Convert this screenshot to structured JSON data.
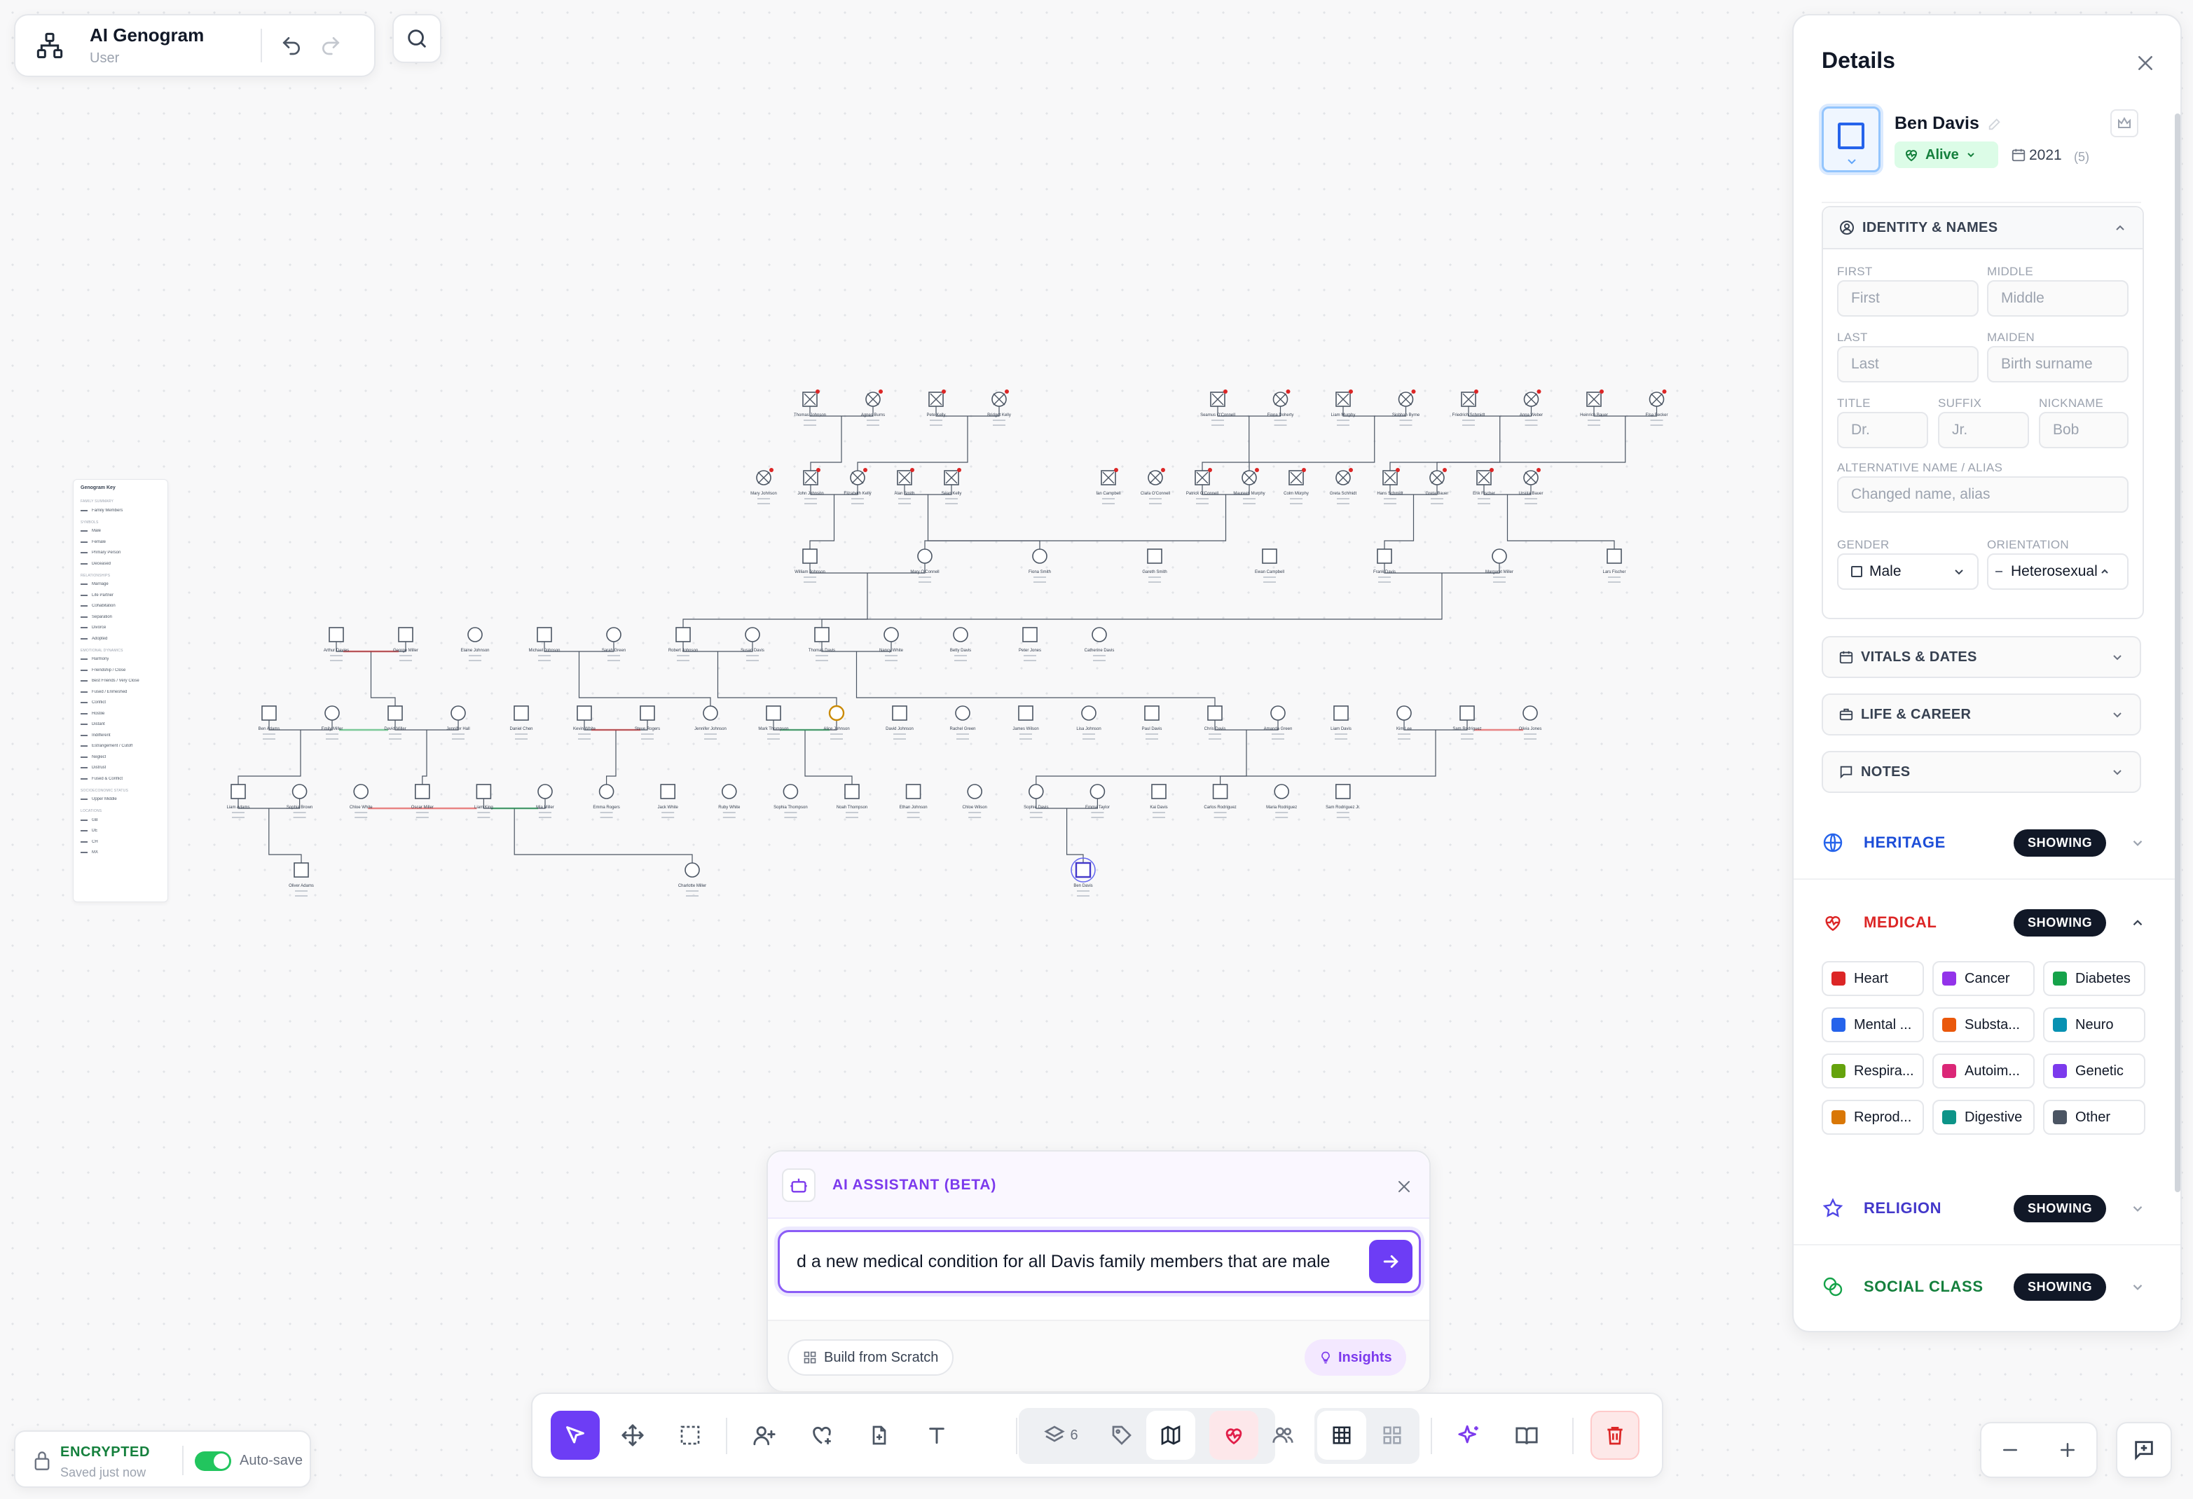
{
  "app": {
    "title": "AI Genogram",
    "role": "User"
  },
  "legend": {
    "title": "Genogram Key",
    "groups": [
      {
        "heading": "FAMILY SUMMARY",
        "items": [
          "Family Members"
        ]
      },
      {
        "heading": "SYMBOLS",
        "items": [
          "Male",
          "Female",
          "Primary Person",
          "Deceased"
        ]
      },
      {
        "heading": "RELATIONSHIPS",
        "items": [
          "Marriage",
          "Life Partner",
          "Cohabitation",
          "Separation",
          "Divorce",
          "Adopted"
        ]
      },
      {
        "heading": "EMOTIONAL DYNAMICS",
        "items": [
          "Harmony",
          "Friendship / Close",
          "Best Friends / Very Close",
          "Fused / Enmeshed",
          "Conflict",
          "Hostile",
          "Distant",
          "Indifferent",
          "Estrangement / Cutoff",
          "Neglect",
          "Distrust",
          "Fused & Conflict"
        ]
      },
      {
        "heading": "SOCIOECONOMIC STATUS",
        "items": [
          "Upper Middle"
        ]
      },
      {
        "heading": "LOCATIONS",
        "items": [
          "GB",
          "DE",
          "CH",
          "MX"
        ]
      }
    ]
  },
  "tree": {
    "rows": [
      {
        "names": [
          "Thomas Johnson",
          "Agnes Burns",
          "Pete Kelly",
          "Bridget Kelly"
        ]
      },
      {
        "names": [
          "Seamus O'Connell",
          "Fiona Doherty",
          "Liam Murphy",
          "Siobhan Byrne",
          "Friedrich Schmidt",
          "Anna Weber",
          "Heinrich Bauer",
          "Elsa Becker"
        ]
      },
      {
        "names": [
          "Mary Johnson",
          "John Johnson",
          "Elizabeth Kelly",
          "Alan Smith",
          "Sean Kelly"
        ]
      },
      {
        "names": [
          "Ian Campbell",
          "Clara O'Connell",
          "Patrick O'Connell",
          "Maureen Murphy",
          "Colm Murphy",
          "Greta Schmidt",
          "Hans Schmidt",
          "Greta Bauer",
          "Erik Fischer",
          "Ursula Bauer"
        ]
      },
      {
        "names": [
          "William Johnson",
          "Mary O'Connell",
          "Fiona Smith",
          "Gareth Smith",
          "Ewan Campbell",
          "Frank Davis",
          "Margaret Miller",
          "Lars Fischer"
        ]
      },
      {
        "names": [
          "Arthur Davies",
          "George Miller",
          "Elaine Johnson",
          "Michael Johnson",
          "Sarah Green",
          "Robert Johnson",
          "Susan Davis",
          "Thomas Davis",
          "Nancy White",
          "Betty Davis",
          "Peter Jones",
          "Catherine Davis"
        ]
      },
      {
        "names": [
          "Ben Adams",
          "Emily Miller",
          "David Miller",
          "Jennifer Hall",
          "Daniel Chen",
          "Kevin White",
          "Steve Rogers",
          "Jennifer Johnson",
          "Mark Thompson",
          "Alice Johnson",
          "David Johnson",
          "Rachel Green",
          "James Wilson",
          "Lisa Johnson",
          "Paul Davis",
          "Chris Davis",
          "Amanda Green",
          "Liam Davis",
          "Kim Lee",
          "Sam Rodriguez",
          "Olivia Jones"
        ]
      },
      {
        "names": [
          "Liam Adams",
          "Sophia Brown",
          "Chloe White",
          "Oscar Miller",
          "Liam King",
          "Mia Miller",
          "Emma Rogers",
          "Jack White",
          "Ruby White",
          "Sophia Thompson",
          "Noah Thompson",
          "Ethan Johnson",
          "Chloe Wilson",
          "Sophie Davis",
          "Emma Taylor",
          "Kai Davis",
          "Carlos Rodriguez",
          "Maria Rodriguez",
          "Sam Rodriguez Jr."
        ]
      },
      {
        "names": [
          "Oliver Adams",
          "Charlotte Miller",
          "Ben Davis"
        ]
      }
    ]
  },
  "details": {
    "title": "Details",
    "person": {
      "name": "Ben Davis",
      "status": "Alive",
      "birth_year": "2021",
      "age": "(5)"
    },
    "identity": {
      "heading": "IDENTITY & NAMES",
      "first_label": "FIRST",
      "first_placeholder": "First",
      "middle_label": "MIDDLE",
      "middle_placeholder": "Middle",
      "last_label": "LAST",
      "last_placeholder": "Last",
      "maiden_label": "MAIDEN",
      "maiden_placeholder": "Birth surname",
      "title_label": "TITLE",
      "title_placeholder": "Dr.",
      "suffix_label": "SUFFIX",
      "suffix_placeholder": "Jr.",
      "nickname_label": "NICKNAME",
      "nickname_placeholder": "Bob",
      "alt_label": "ALTERNATIVE NAME / ALIAS",
      "alt_placeholder": "Changed name, alias",
      "gender_label": "GENDER",
      "gender_value": "Male",
      "orientation_label": "ORIENTATION",
      "orientation_value": "Heterosexual"
    },
    "sections": [
      "VITALS & DATES",
      "LIFE & CAREER",
      "NOTES"
    ],
    "layers": {
      "heritage": "HERITAGE",
      "medical": "MEDICAL",
      "religion": "RELIGION",
      "social": "SOCIAL CLASS",
      "showing": "SHOWING"
    },
    "conditions": [
      {
        "label": "Heart",
        "color": "#dc2626"
      },
      {
        "label": "Cancer",
        "color": "#9333ea"
      },
      {
        "label": "Diabetes",
        "color": "#16a34a"
      },
      {
        "label": "Mental ...",
        "color": "#2563eb"
      },
      {
        "label": "Substa...",
        "color": "#ea580c"
      },
      {
        "label": "Neuro",
        "color": "#0891b2"
      },
      {
        "label": "Respira...",
        "color": "#65a30d"
      },
      {
        "label": "Autoim...",
        "color": "#db2777"
      },
      {
        "label": "Genetic",
        "color": "#7c3aed"
      },
      {
        "label": "Reprod...",
        "color": "#d97706"
      },
      {
        "label": "Digestive",
        "color": "#0d9488"
      },
      {
        "label": "Other",
        "color": "#4b5563"
      }
    ]
  },
  "assistant": {
    "title": "AI ASSISTANT (BETA)",
    "input_value": "d a new medical condition for all Davis family members that are male",
    "build_label": "Build from Scratch",
    "insights_label": "Insights"
  },
  "status": {
    "encrypted": "ENCRYPTED",
    "saved": "Saved just now",
    "autosave": "Auto-save"
  },
  "toolbar": {
    "layers_count": "6"
  },
  "colors": {
    "accent": "#6d3df5",
    "medical": "#dc2626",
    "heritage": "#2563eb",
    "religion": "#4f46e5",
    "social": "#16a34a",
    "encrypted": "#15803d"
  }
}
